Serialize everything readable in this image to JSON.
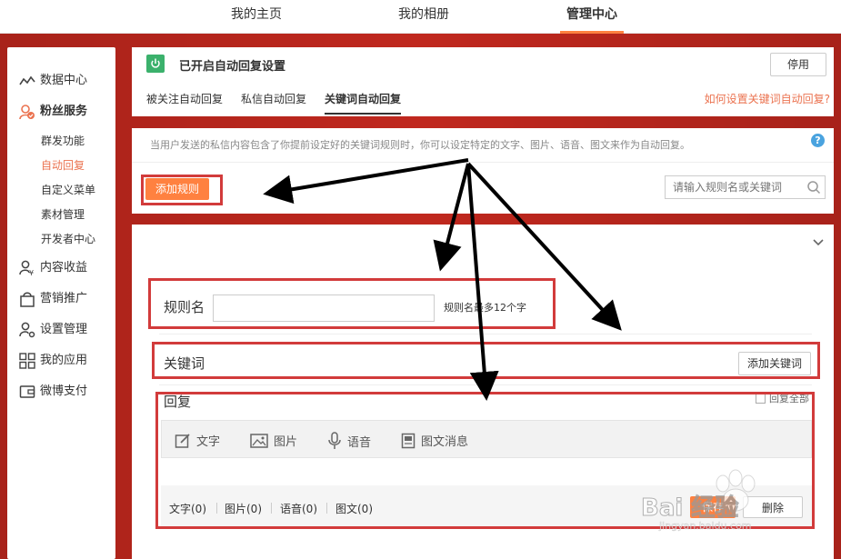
{
  "topnav": {
    "tabs": [
      "我的主页",
      "我的相册",
      "管理中心"
    ],
    "active_tab": "管理中心"
  },
  "sidebar": {
    "items": [
      {
        "label": "数据中心",
        "icon": "trend-line-icon"
      },
      {
        "label": "粉丝服务",
        "icon": "fans-icon"
      },
      {
        "label": "内容收益",
        "icon": "user-yen-icon"
      },
      {
        "label": "营销推广",
        "icon": "bag-icon"
      },
      {
        "label": "设置管理",
        "icon": "user-gear-icon"
      },
      {
        "label": "我的应用",
        "icon": "grid-icon"
      },
      {
        "label": "微博支付",
        "icon": "wallet-icon"
      }
    ],
    "sub_items": [
      "群发功能",
      "自动回复",
      "自定义菜单",
      "素材管理",
      "开发者中心"
    ],
    "active_sub": "自动回复"
  },
  "header": {
    "status_title": "已开启自动回复设置",
    "disable_button": "停用",
    "tabs": [
      "被关注自动回复",
      "私信自动回复",
      "关键词自动回复"
    ],
    "active_tab": "关键词自动回复",
    "help_link": "如何设置关键词自动回复?"
  },
  "desc": {
    "text": "当用户发送的私信内容包含了你提前设定好的关键词规则时，你可以设定特定的文字、图片、语音、图文来作为自动回复。",
    "add_rule_button": "添加规则",
    "search_placeholder": "请输入规则名或关键词"
  },
  "form": {
    "rule_name_label": "规则名",
    "rule_name_value": "",
    "rule_name_hint": "规则名最多12个字",
    "keyword_label": "关键词",
    "add_keyword_button": "添加关键词",
    "reply_label": "回复",
    "reply_all_label": "回复全部",
    "media_buttons": [
      {
        "label": "文字",
        "icon": "edit-icon"
      },
      {
        "label": "图片",
        "icon": "image-icon"
      },
      {
        "label": "语音",
        "icon": "microphone-icon"
      },
      {
        "label": "图文消息",
        "icon": "article-icon"
      }
    ],
    "counts": [
      "文字(0)",
      "图片(0)",
      "语音(0)",
      "图文(0)"
    ],
    "save_button": "保存",
    "delete_button": "删除"
  },
  "watermark": {
    "text": "Bai 经验",
    "url_text": "jingyan.baidu.com"
  },
  "colors": {
    "accent_orange": "#ff8140",
    "link_orange": "#eb7350",
    "background_red": "#b8261c",
    "annotation_red": "#d23b3b",
    "status_green": "#3bb16c",
    "help_blue": "#4aa3df"
  }
}
